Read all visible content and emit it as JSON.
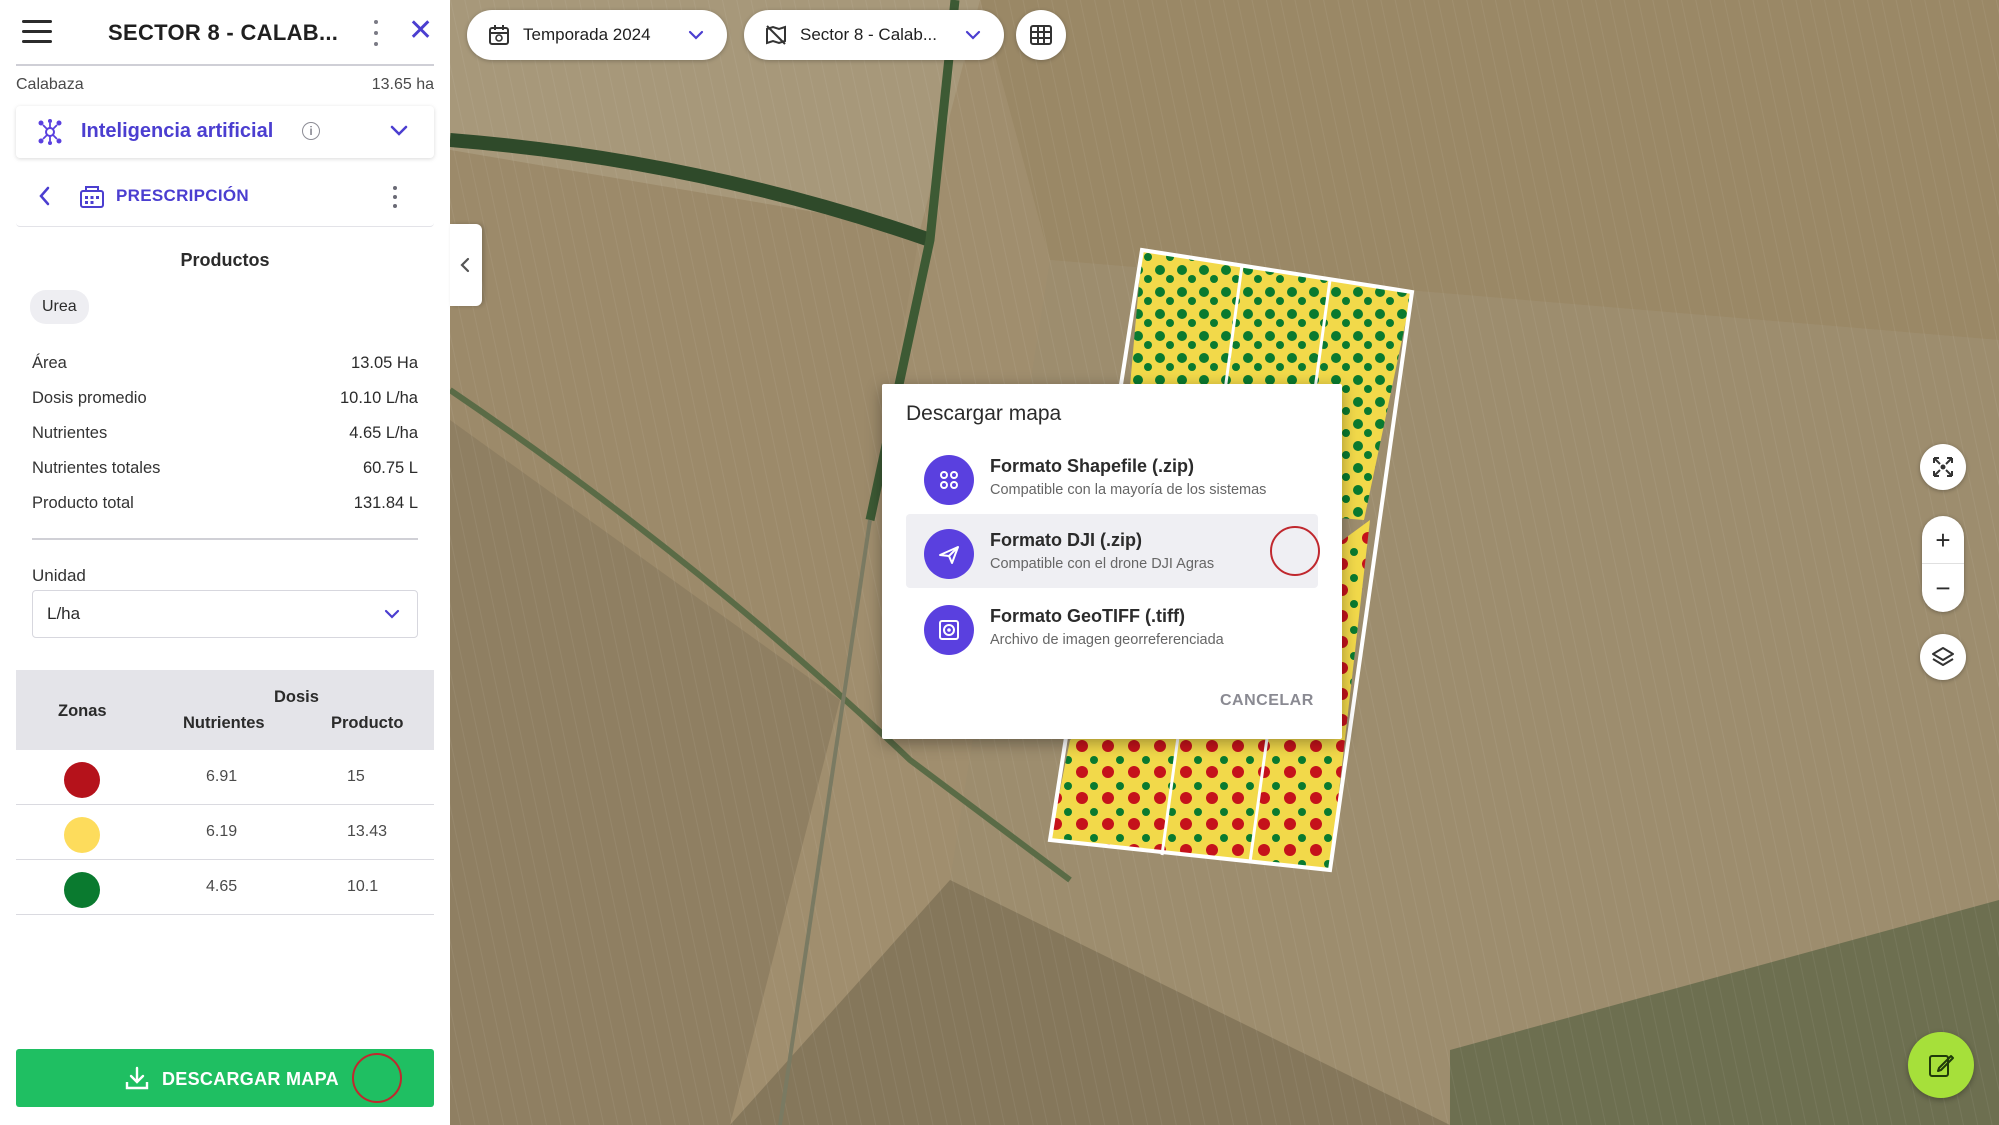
{
  "sidebar": {
    "title": "SECTOR 8 - CALAB...",
    "crop": "Calabaza",
    "area": "13.65 ha",
    "ai_section": {
      "label": "Inteligencia artificial"
    },
    "prescription": {
      "label": "PRESCRIPCIÓN"
    },
    "products": {
      "heading": "Productos",
      "chip": "Urea",
      "stats": [
        {
          "label": "Área",
          "value": "13.05 Ha"
        },
        {
          "label": "Dosis promedio",
          "value": "10.10 L/ha"
        },
        {
          "label": "Nutrientes",
          "value": "4.65 L/ha"
        },
        {
          "label": "Nutrientes totales",
          "value": "60.75 L"
        },
        {
          "label": "Producto total",
          "value": "131.84 L"
        }
      ],
      "unit_label": "Unidad",
      "unit_value": "L/ha"
    },
    "zones_table": {
      "col_zones": "Zonas",
      "col_dose": "Dosis",
      "col_nutrients": "Nutrientes",
      "col_product": "Producto",
      "rows": [
        {
          "color": "#b5121b",
          "nutrients": "6.91",
          "product": "15"
        },
        {
          "color": "#fddc5c",
          "nutrients": "6.19",
          "product": "13.43"
        },
        {
          "color": "#0a7a2f",
          "nutrients": "4.65",
          "product": "10.1"
        }
      ]
    },
    "download_button": "DESCARGAR MAPA"
  },
  "toolbar": {
    "season": "Temporada 2024",
    "sector": "Sector 8 - Calab..."
  },
  "dialog": {
    "title": "Descargar mapa",
    "options": [
      {
        "title": "Formato Shapefile (.zip)",
        "subtitle": "Compatible con la mayoría de los sistemas",
        "icon": "shapefile-icon"
      },
      {
        "title": "Formato DJI (.zip)",
        "subtitle": "Compatible con el drone DJI Agras",
        "icon": "drone-icon"
      },
      {
        "title": "Formato GeoTIFF (.tiff)",
        "subtitle": "Archivo de imagen georreferenciada",
        "icon": "geotiff-icon"
      }
    ],
    "cancel": "CANCELAR"
  },
  "map_controls": {
    "zoom_in": "+",
    "zoom_out": "−"
  },
  "colors": {
    "accent": "#4b3ed0",
    "primary_button": "#1fbf62",
    "fab": "#a6e03a",
    "highlight_ring": "#c0282e"
  }
}
